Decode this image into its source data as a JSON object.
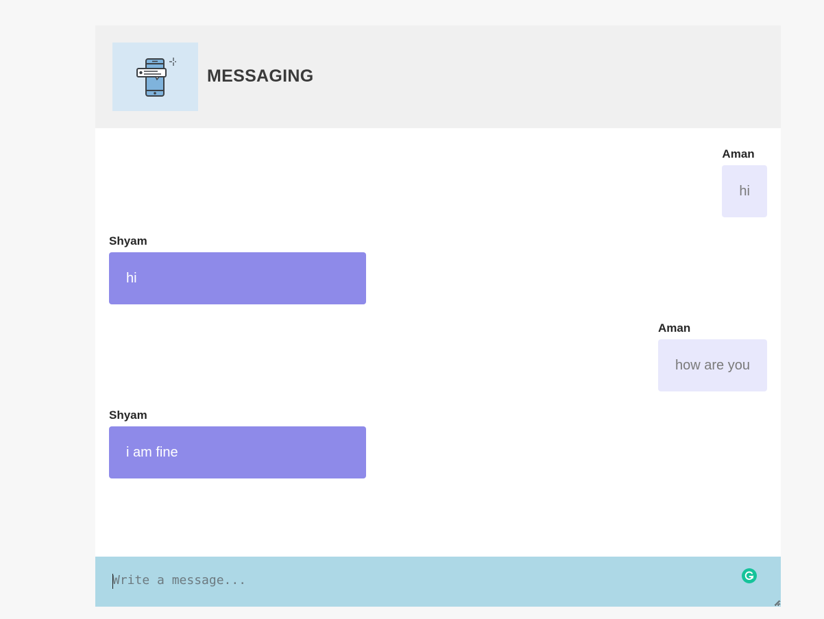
{
  "header": {
    "title": "MESSAGING",
    "logo_icon": "phone-chat-icon"
  },
  "messages": [
    {
      "sender": "Aman",
      "text": "hi",
      "side": "sent"
    },
    {
      "sender": "Shyam",
      "text": "hi",
      "side": "received"
    },
    {
      "sender": "Aman",
      "text": "how are you",
      "side": "sent"
    },
    {
      "sender": "Shyam",
      "text": "i am fine",
      "side": "received"
    }
  ],
  "composer": {
    "placeholder": "Write a message...",
    "value": ""
  },
  "colors": {
    "header_bg": "#f0f0f0",
    "logo_bg": "#d6e7f4",
    "sent_bubble": "#e8e8fc",
    "received_bubble": "#8e8ae9",
    "composer_bg": "#add8e6",
    "grammar_badge": "#15c39a"
  }
}
